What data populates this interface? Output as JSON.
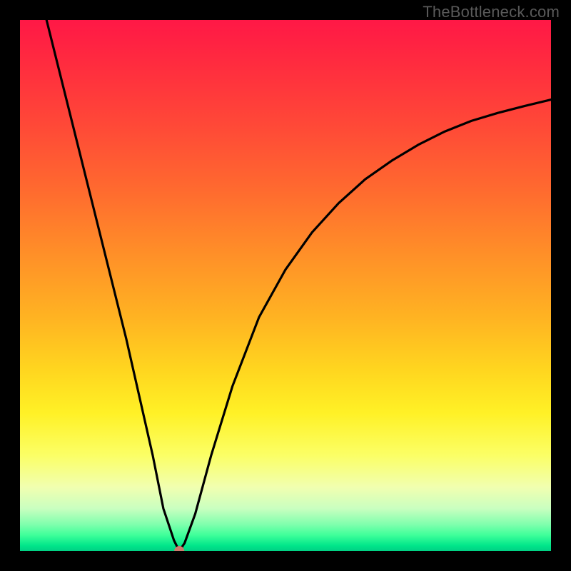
{
  "watermark": "TheBottleneck.com",
  "chart_data": {
    "type": "line",
    "title": "",
    "xlabel": "",
    "ylabel": "",
    "xlim": [
      0,
      100
    ],
    "ylim": [
      0,
      100
    ],
    "grid": false,
    "legend": false,
    "background": "rainbow-gradient-vertical",
    "gradient_stops": [
      {
        "pct": 0,
        "color": "#ff1846"
      },
      {
        "pct": 50,
        "color": "#ffc020"
      },
      {
        "pct": 85,
        "color": "#f8ff80"
      },
      {
        "pct": 100,
        "color": "#00d084"
      }
    ],
    "series": [
      {
        "name": "bottleneck-curve",
        "x": [
          5,
          10,
          15,
          20,
          25,
          27,
          29,
          30,
          31,
          33,
          36,
          40,
          45,
          50,
          55,
          60,
          65,
          70,
          75,
          80,
          85,
          90,
          95,
          100
        ],
        "y": [
          100,
          80,
          60,
          40,
          18,
          8,
          2,
          0,
          1.5,
          7,
          18,
          31,
          44,
          53,
          60,
          65.5,
          70,
          73.5,
          76.5,
          79,
          81,
          82.5,
          83.8,
          85
        ]
      }
    ],
    "marker": {
      "x": 30,
      "y": 0,
      "color": "#cd7a6c",
      "radius_px": 7
    }
  }
}
